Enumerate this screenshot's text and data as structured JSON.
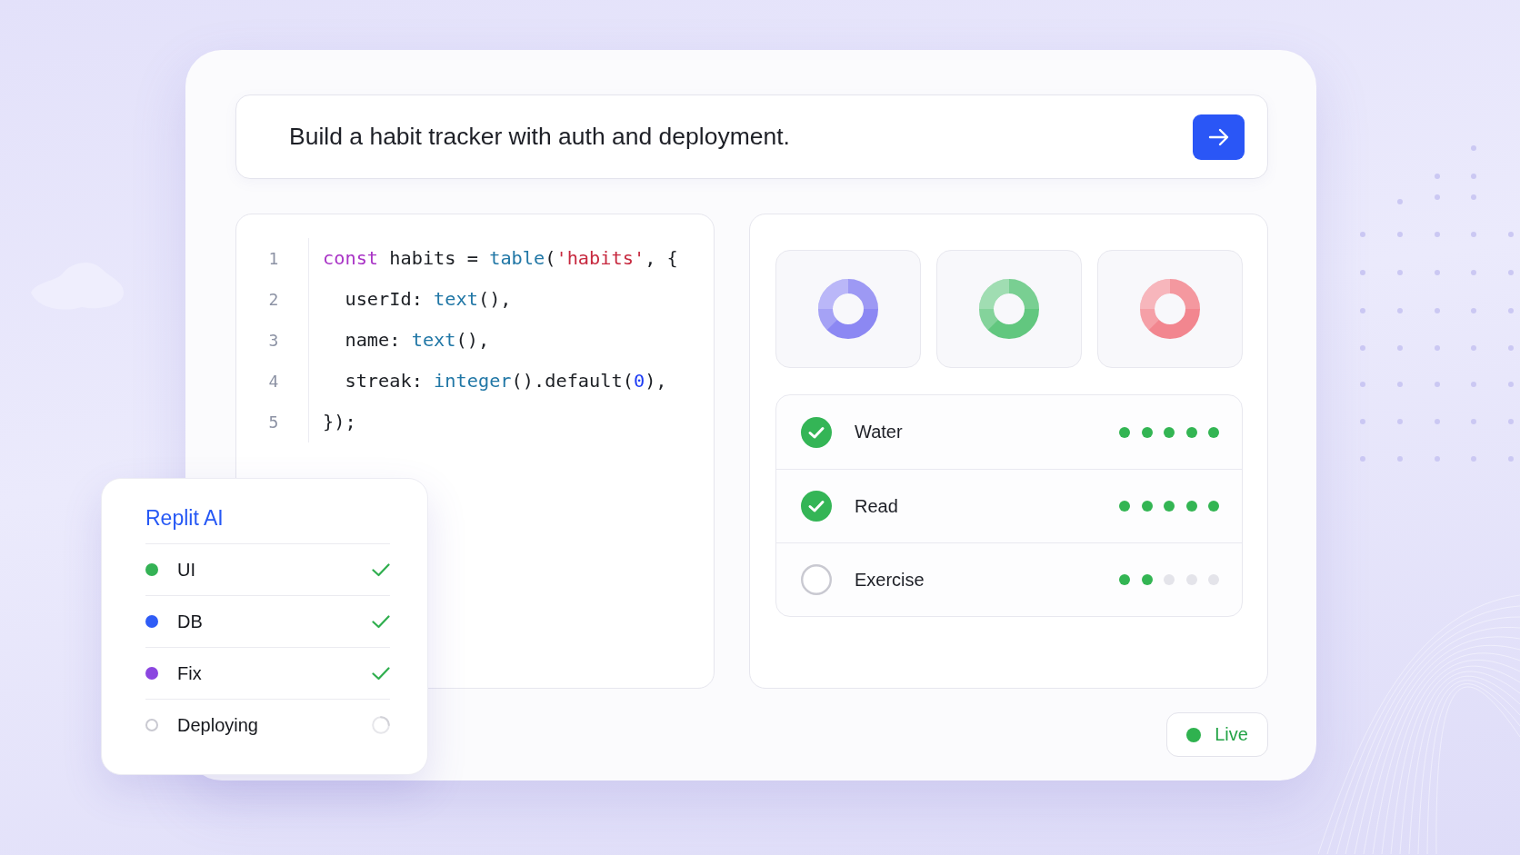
{
  "prompt": {
    "value": "Build a habit tracker with auth and deployment."
  },
  "code": {
    "lines": [
      {
        "number": "1",
        "tokens": [
          {
            "kind": "keyword",
            "text": "const"
          },
          {
            "kind": "plain",
            "text": " habits = "
          },
          {
            "kind": "function",
            "text": "table"
          },
          {
            "kind": "plain",
            "text": "("
          },
          {
            "kind": "string",
            "text": "'habits'"
          },
          {
            "kind": "plain",
            "text": ", {"
          }
        ]
      },
      {
        "number": "2",
        "tokens": [
          {
            "kind": "plain",
            "text": "  userId: "
          },
          {
            "kind": "function",
            "text": "text"
          },
          {
            "kind": "plain",
            "text": "(),"
          }
        ]
      },
      {
        "number": "3",
        "tokens": [
          {
            "kind": "plain",
            "text": "  name: "
          },
          {
            "kind": "function",
            "text": "text"
          },
          {
            "kind": "plain",
            "text": "(),"
          }
        ]
      },
      {
        "number": "4",
        "tokens": [
          {
            "kind": "plain",
            "text": "  streak: "
          },
          {
            "kind": "function",
            "text": "integer"
          },
          {
            "kind": "plain",
            "text": "().default("
          },
          {
            "kind": "number",
            "text": "0"
          },
          {
            "kind": "plain",
            "text": "),"
          }
        ]
      },
      {
        "number": "5",
        "tokens": [
          {
            "kind": "plain",
            "text": "});"
          }
        ]
      }
    ]
  },
  "stat_cards": [
    {
      "color": "#8c88f3"
    },
    {
      "color": "#62c77f"
    },
    {
      "color": "#f2868f"
    }
  ],
  "habits": [
    {
      "name": "Water",
      "done": true,
      "stars": 5
    },
    {
      "name": "Read",
      "done": true,
      "stars": 5
    },
    {
      "name": "Exercise",
      "done": false,
      "stars": 2
    }
  ],
  "status_badge": {
    "label": "Live"
  },
  "assistant_card": {
    "title": "Replit AI",
    "steps": [
      {
        "label": "UI",
        "color": "#34b255",
        "done": true
      },
      {
        "label": "DB",
        "color": "#2f5cf6",
        "done": true
      },
      {
        "label": "Fix",
        "color": "#8b46e0",
        "done": true
      },
      {
        "label": "Deploying",
        "color": "#c9c9d1",
        "done": false
      }
    ]
  }
}
